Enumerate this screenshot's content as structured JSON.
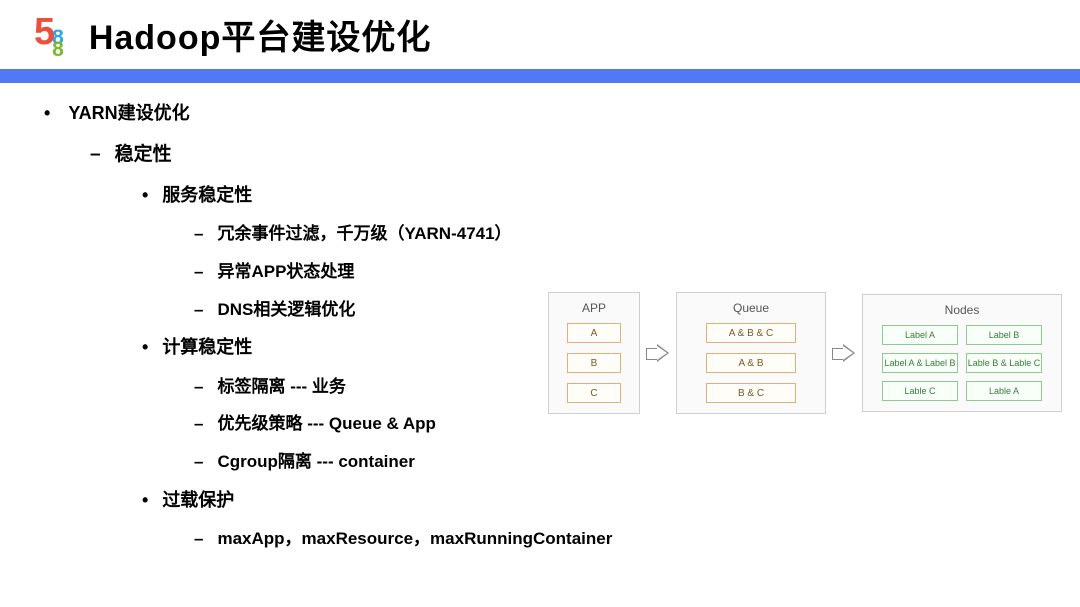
{
  "header": {
    "logo_5": "5",
    "logo_8": "8",
    "title": "Hadoop平台建设优化"
  },
  "content": {
    "lvl1_0": "YARN建设优化",
    "lvl2_0": "稳定性",
    "lvl3_0": "服务稳定性",
    "lvl4_0": "冗余事件过滤，千万级（YARN-4741）",
    "lvl4_1": "异常APP状态处理",
    "lvl4_2": "DNS相关逻辑优化",
    "lvl3_1": "计算稳定性",
    "lvl4_3": "标签隔离  --- 业务",
    "lvl4_4": "优先级策略 --- Queue & App",
    "lvl4_5": "Cgroup隔离 --- container",
    "lvl3_2": "过载保护",
    "lvl4_6": "maxApp，maxResource，maxRunningContainer"
  },
  "diagram": {
    "panel_app_title": "APP",
    "app_items": {
      "a": "A",
      "b": "B",
      "c": "C"
    },
    "panel_queue_title": "Queue",
    "queue_items": {
      "q0": "A & B & C",
      "q1": "A & B",
      "q2": "B & C"
    },
    "panel_nodes_title": "Nodes",
    "node_items": {
      "n0": "Label A",
      "n1": "Label B",
      "n2": "Label A & Label B",
      "n3": "Lable B & Lable C",
      "n4": "Lable C",
      "n5": "Lable A"
    }
  }
}
